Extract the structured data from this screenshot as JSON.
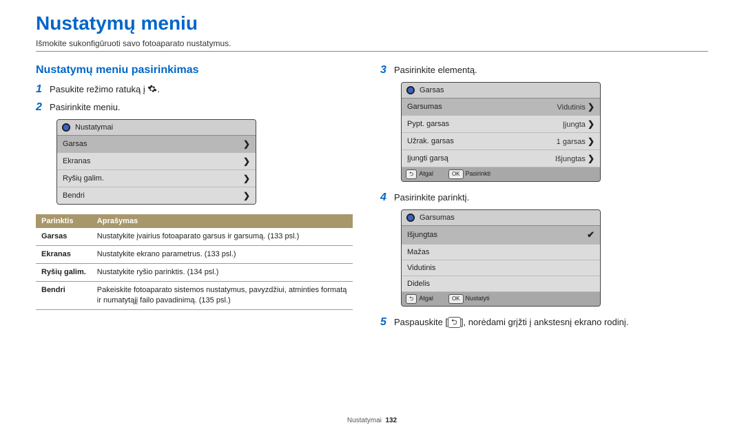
{
  "title": "Nustatymų meniu",
  "subtitle": "Išmokite sukonfigūruoti savo fotoaparato nustatymus.",
  "section_heading": "Nustatymų meniu pasirinkimas",
  "steps_left": {
    "s1": {
      "num": "1",
      "text_before": "Pasukite režimo ratuką į ",
      "text_after": "."
    },
    "s2": {
      "num": "2",
      "text": "Pasirinkite meniu."
    }
  },
  "steps_right": {
    "s3": {
      "num": "3",
      "text": "Pasirinkite elementą."
    },
    "s4": {
      "num": "4",
      "text": "Pasirinkite parinktį."
    },
    "s5": {
      "num": "5",
      "text_before": "Paspauskite [",
      "text_after": "], norėdami grįžti į ankstesnį ekrano rodinį."
    }
  },
  "mini1": {
    "header": "Nustatymai",
    "rows": [
      {
        "label": "Garsas"
      },
      {
        "label": "Ekranas"
      },
      {
        "label": "Ryšių galim."
      },
      {
        "label": "Bendri"
      }
    ]
  },
  "mini2": {
    "header": "Garsas",
    "rows": [
      {
        "label": "Garsumas",
        "value": "Vidutinis",
        "sel": true
      },
      {
        "label": "Pypt. garsas",
        "value": "Įjungta"
      },
      {
        "label": "Užrak. garsas",
        "value": "1 garsas"
      },
      {
        "label": "Įjungti garsą",
        "value": "Išjungtas"
      }
    ],
    "footer": {
      "back": "Atgal",
      "ok_key": "OK",
      "ok": "Pasirinkti"
    }
  },
  "mini3": {
    "header": "Garsumas",
    "rows": [
      {
        "label": "Išjungtas",
        "sel": true,
        "check": true
      },
      {
        "label": "Mažas"
      },
      {
        "label": "Vidutinis"
      },
      {
        "label": "Didelis"
      }
    ],
    "footer": {
      "back": "Atgal",
      "ok_key": "OK",
      "ok": "Nustatyti"
    }
  },
  "desc_table": {
    "head": {
      "option": "Parinktis",
      "desc": "Aprašymas"
    },
    "rows": [
      {
        "k": "Garsas",
        "v": "Nustatykite įvairius fotoaparato garsus ir garsumą. (133 psl.)"
      },
      {
        "k": "Ekranas",
        "v": "Nustatykite ekrano parametrus. (133 psl.)"
      },
      {
        "k": "Ryšių galim.",
        "v": "Nustatykite ryšio parinktis. (134 psl.)"
      },
      {
        "k": "Bendri",
        "v": "Pakeiskite fotoaparato sistemos nustatymus, pavyzdžiui, atminties formatą ir numatytąjį failo pavadinimą. (135 psl.)"
      }
    ]
  },
  "footer": {
    "section": "Nustatymai",
    "page": "132"
  }
}
